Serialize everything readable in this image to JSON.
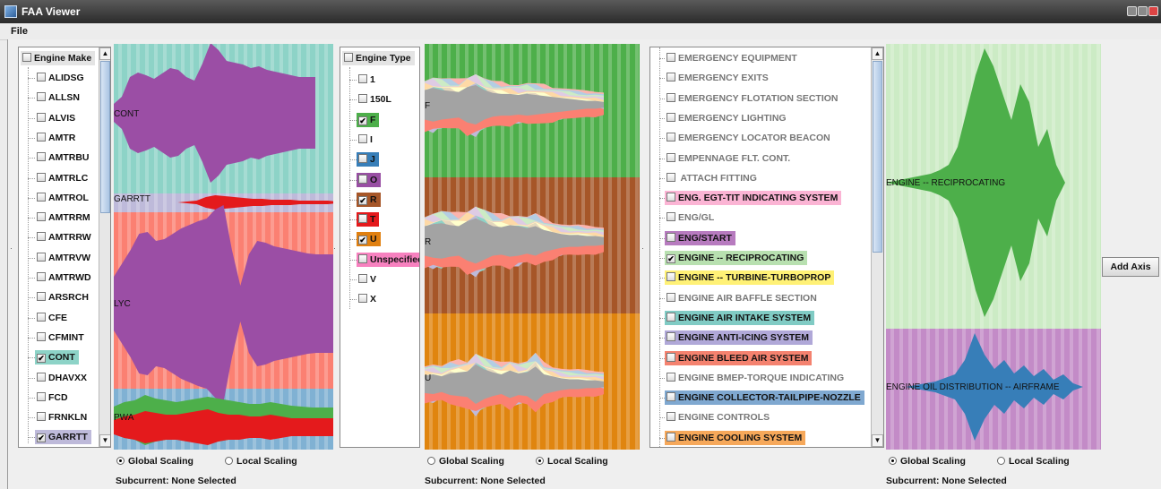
{
  "window": {
    "title": "FAA Viewer"
  },
  "menu": {
    "file": "File"
  },
  "engine_make": {
    "header": "Engine Make",
    "items": [
      {
        "label": "ALIDSG",
        "checked": false
      },
      {
        "label": "ALLSN",
        "checked": false
      },
      {
        "label": "ALVIS",
        "checked": false
      },
      {
        "label": "AMTR",
        "checked": false
      },
      {
        "label": "AMTRBU",
        "checked": false
      },
      {
        "label": "AMTRLC",
        "checked": false
      },
      {
        "label": "AMTROL",
        "checked": false
      },
      {
        "label": "AMTRRM",
        "checked": false
      },
      {
        "label": "AMTRRW",
        "checked": false
      },
      {
        "label": "AMTRVW",
        "checked": false
      },
      {
        "label": "AMTRWD",
        "checked": false
      },
      {
        "label": "ARSRCH",
        "checked": false
      },
      {
        "label": "CFE",
        "checked": false
      },
      {
        "label": "CFMINT",
        "checked": false
      },
      {
        "label": "CONT",
        "checked": true,
        "color": "#8dd3c7"
      },
      {
        "label": "DHAVXX",
        "checked": false
      },
      {
        "label": "FCD",
        "checked": false
      },
      {
        "label": "FRNKLN",
        "checked": false
      },
      {
        "label": "GARRTT",
        "checked": true,
        "color": "#bebada"
      }
    ]
  },
  "engine_type": {
    "header": "Engine Type",
    "items": [
      {
        "label": "1",
        "checked": false
      },
      {
        "label": "150L",
        "checked": false
      },
      {
        "label": "F",
        "checked": true,
        "color": "#4daf4a"
      },
      {
        "label": "I",
        "checked": false
      },
      {
        "label": "J",
        "checked": false,
        "color": "#377eb8"
      },
      {
        "label": "O",
        "checked": false,
        "color": "#984ea3"
      },
      {
        "label": "R",
        "checked": true,
        "color": "#a65628"
      },
      {
        "label": "T",
        "checked": false,
        "color": "#e41a1c"
      },
      {
        "label": "U",
        "checked": true,
        "color": "#e08010"
      },
      {
        "label": "Unspecified",
        "checked": false,
        "color": "#f781bf"
      },
      {
        "label": "V",
        "checked": false
      },
      {
        "label": "X",
        "checked": false
      }
    ]
  },
  "systems": {
    "items": [
      {
        "label": "EMERGENCY EQUIPMENT",
        "checked": false,
        "dim": true
      },
      {
        "label": "EMERGENCY EXITS",
        "checked": false,
        "dim": true
      },
      {
        "label": "EMERGENCY FLOTATION SECTION",
        "checked": false,
        "dim": true
      },
      {
        "label": "EMERGENCY LIGHTING",
        "checked": false,
        "dim": true
      },
      {
        "label": "EMERGENCY LOCATOR BEACON",
        "checked": false,
        "dim": true
      },
      {
        "label": "EMPENNAGE FLT. CONT.",
        "checked": false,
        "dim": true
      },
      {
        "label": " ATTACH FITTING",
        "checked": false,
        "dim": true
      },
      {
        "label": "ENG. EGT-TIT INDICATING SYSTEM",
        "checked": false,
        "color": "#fbb4d4"
      },
      {
        "label": "ENG/GL",
        "checked": false,
        "dim": true
      },
      {
        "label": "ENG/START",
        "checked": false,
        "color": "#b77bbf"
      },
      {
        "label": "ENGINE -- RECIPROCATING",
        "checked": true,
        "color": "#b8e0b0"
      },
      {
        "label": "ENGINE -- TURBINE-TURBOPROP",
        "checked": false,
        "color": "#fff176"
      },
      {
        "label": "ENGINE AIR BAFFLE SECTION",
        "checked": false,
        "dim": true
      },
      {
        "label": "ENGINE AIR INTAKE SYSTEM",
        "checked": false,
        "color": "#80cbc4"
      },
      {
        "label": "ENGINE ANTI-ICING SYSTEM",
        "checked": false,
        "color": "#b0a8d8"
      },
      {
        "label": "ENGINE BLEED AIR SYSTEM",
        "checked": false,
        "color": "#f4826f"
      },
      {
        "label": "ENGINE BMEP-TORQUE INDICATING",
        "checked": false,
        "dim": true
      },
      {
        "label": "ENGINE COLLECTOR-TAILPIPE-NOZZLE",
        "checked": false,
        "color": "#7fa8d0"
      },
      {
        "label": "ENGINE CONTROLS",
        "checked": false,
        "dim": true
      },
      {
        "label": "ENGINE COOLING SYSTEM",
        "checked": false,
        "color": "#f6a85a"
      }
    ]
  },
  "streams": {
    "make": [
      "CONT",
      "GARRTT",
      "LYC",
      "PWA"
    ],
    "type": [
      "F",
      "R",
      "U"
    ],
    "system": [
      "ENGINE -- RECIPROCATING",
      "ENGINE OIL DISTRIBUTION -- AIRFRAME"
    ]
  },
  "scaling": {
    "global": "Global Scaling",
    "local": "Local Scaling",
    "panels": [
      {
        "selected": "global"
      },
      {
        "selected": "local"
      },
      {
        "selected": "global"
      }
    ]
  },
  "subcurrent": "Subcurrent: None Selected",
  "add_axis": "Add Axis",
  "colors": {
    "cont_band": "#8dd3c7",
    "garrtt_band": "#bebada",
    "lyc_band": "#fb8072",
    "pwa_band": "#80b1d3",
    "purple": "#9b4ea5",
    "red": "#e41a1c",
    "green": "#4daf4a",
    "f_band": "#4daf4a",
    "r_band": "#a65628",
    "u_band": "#e0850f",
    "recip_band": "#ccebc5",
    "oil_band": "#c38bc7",
    "blue": "#377eb8"
  }
}
